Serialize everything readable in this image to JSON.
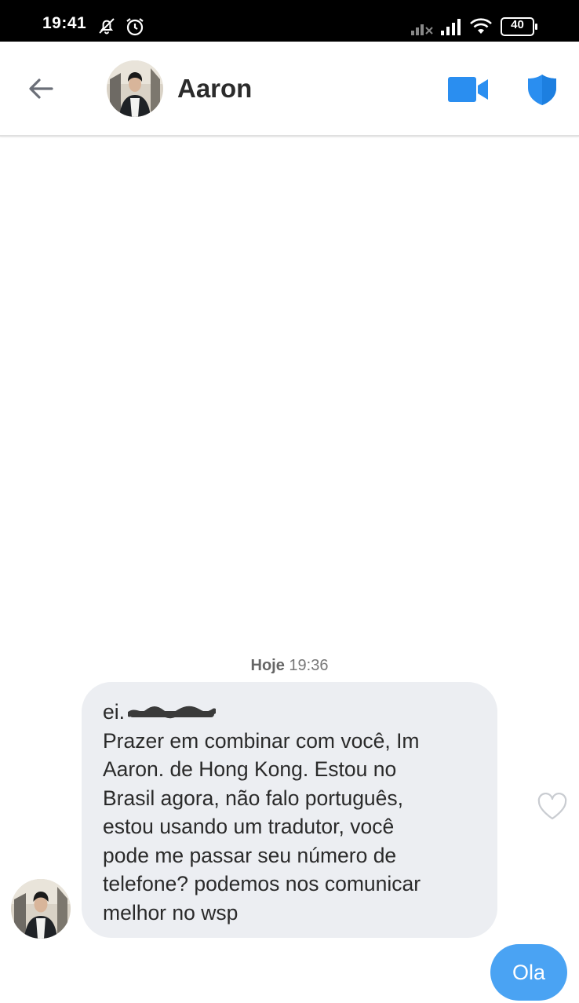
{
  "status_bar": {
    "time": "19:41",
    "battery": "40",
    "icons": [
      "mute-notification-icon",
      "alarm-icon",
      "signal-off-icon",
      "signal-icon",
      "wifi-icon",
      "battery-icon"
    ]
  },
  "header": {
    "contact_name": "Aaron",
    "icons": [
      "back-arrow-icon",
      "video-call-icon",
      "shield-icon"
    ],
    "accent_color": "#2a8ef0"
  },
  "chat": {
    "timestamp_day": "Hoje",
    "timestamp_time": "19:36",
    "incoming_message": {
      "lines": [
        "ei.",
        "Prazer em combinar com você, Im",
        "Aaron. de Hong Kong. Estou no",
        "Brasil agora, não falo português,",
        "estou usando um tradutor, você",
        "pode me passar seu número de",
        "telefone? podemos nos comunicar",
        "melhor no wsp"
      ],
      "bubble_color": "#eceef2"
    },
    "outgoing_message": {
      "text": "Ola",
      "bubble_color": "#4aa3f3"
    }
  }
}
